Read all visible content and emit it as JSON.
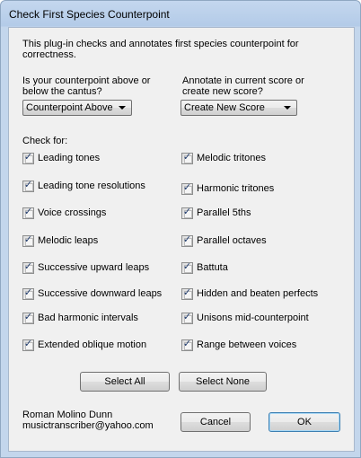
{
  "window": {
    "title": "Check First Species Counterpoint"
  },
  "description": "This plug-in checks and annotates first species counterpoint for correctness.",
  "position": {
    "question": "Is your counterpoint above or below the cantus?",
    "selected": "Counterpoint Above"
  },
  "annotate": {
    "question": "Annotate in current score or create new score?",
    "selected": "Create New Score"
  },
  "check_for_label": "Check for:",
  "checks_left": [
    {
      "label": "Leading tones",
      "checked": true
    },
    {
      "label": "Leading tone resolutions",
      "checked": true
    },
    {
      "label": "Voice crossings",
      "checked": true
    },
    {
      "label": "Melodic leaps",
      "checked": true
    },
    {
      "label": "Successive upward leaps",
      "checked": true
    },
    {
      "label": "Successive downward leaps",
      "checked": true
    },
    {
      "label": "Bad harmonic intervals",
      "checked": true
    },
    {
      "label": "Extended oblique motion",
      "checked": true
    }
  ],
  "checks_right": [
    {
      "label": "Melodic tritones",
      "checked": true
    },
    {
      "label": "Harmonic tritones",
      "checked": true
    },
    {
      "label": "Parallel 5ths",
      "checked": true
    },
    {
      "label": "Parallel octaves",
      "checked": true
    },
    {
      "label": "Battuta",
      "checked": true
    },
    {
      "label": "Hidden and beaten perfects",
      "checked": true
    },
    {
      "label": "Unisons mid-counterpoint",
      "checked": true
    },
    {
      "label": "Range between voices",
      "checked": true
    }
  ],
  "buttons": {
    "select_all": "Select All",
    "select_none": "Select None",
    "cancel": "Cancel",
    "ok": "OK"
  },
  "author": {
    "name": "Roman Molino Dunn",
    "email": "musictranscriber@yahoo.com"
  }
}
